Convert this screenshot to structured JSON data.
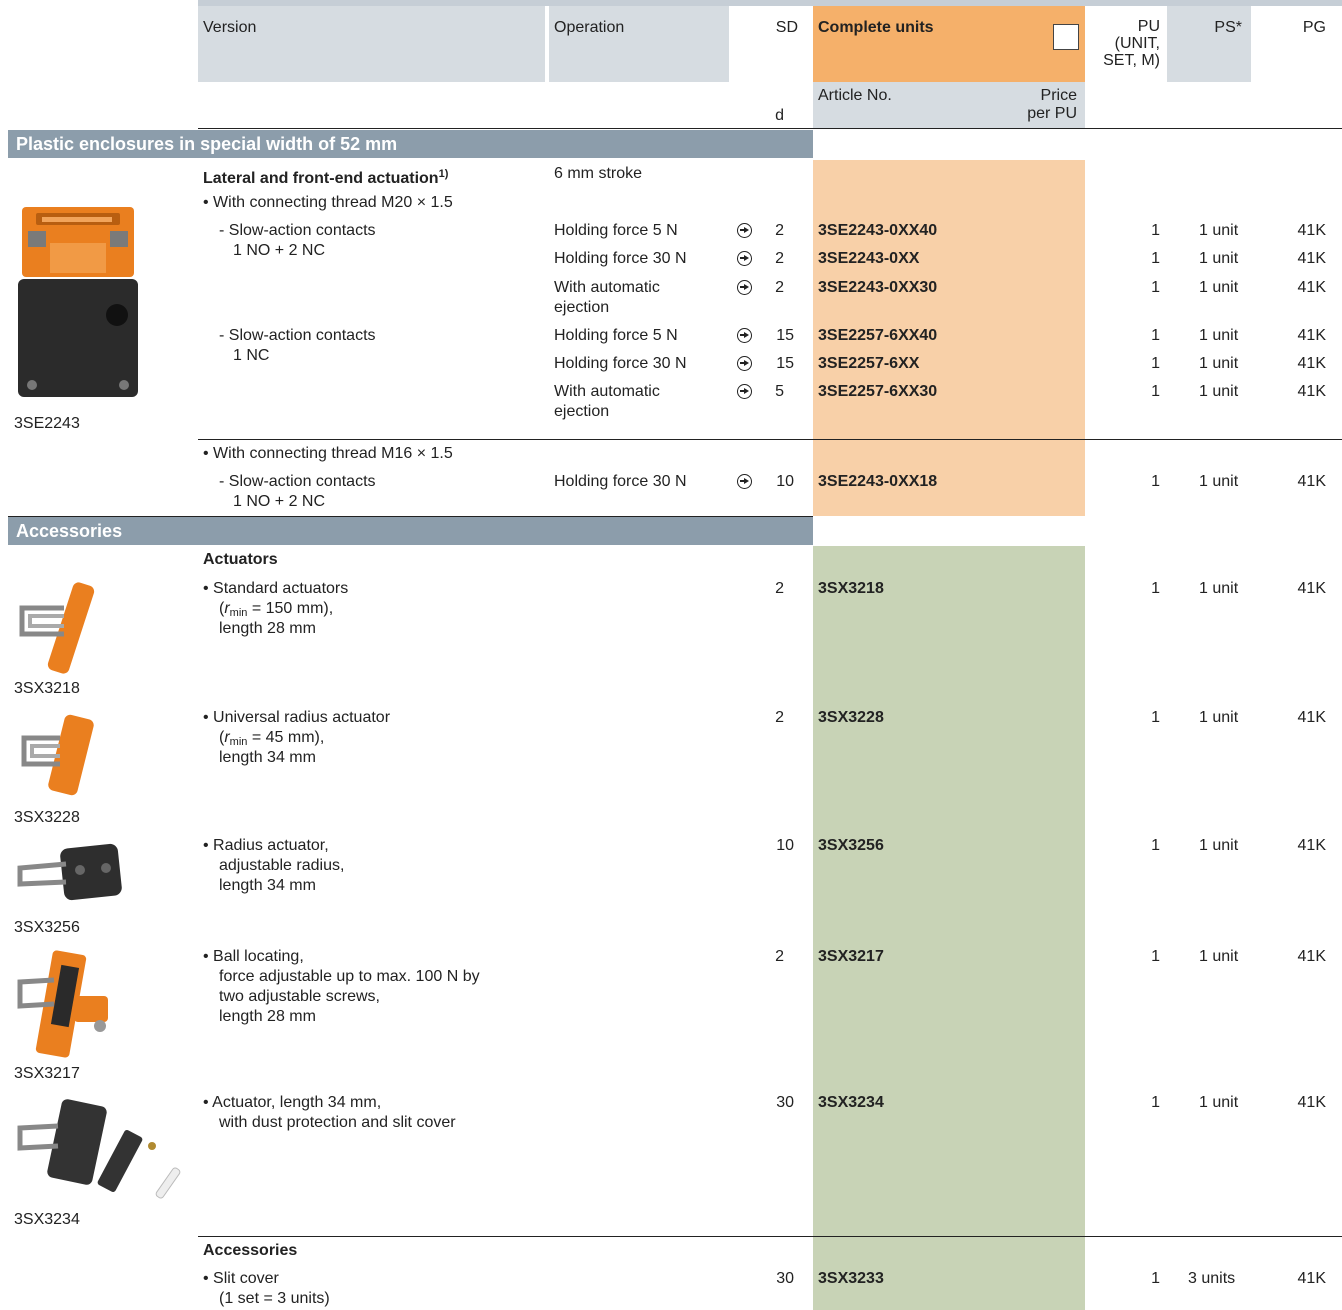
{
  "header": {
    "version": "Version",
    "operation": "Operation",
    "sd": "SD",
    "sd_unit": "d",
    "complete_units": "Complete units",
    "article_no": "Article No.",
    "price_1": "Price",
    "price_2": "per PU",
    "pu_1": "PU",
    "pu_2": "(UNIT,",
    "pu_3": "SET, M)",
    "ps": "PS*",
    "pg": "PG"
  },
  "section1": {
    "title": "Plastic enclosures in special width of 52 mm",
    "subheading": "Lateral and front-end actuation",
    "subheading_sup": "1)",
    "stroke": "6 mm stroke",
    "thread_m20": "• With connecting thread M20 × 1.5",
    "thread_m16": "• With connecting thread M16 × 1.5",
    "contacts_a1": "- Slow-action contacts",
    "contacts_a2": "1 NO + 2 NC",
    "contacts_b1": "- Slow-action contacts",
    "contacts_b2": "1 NC",
    "contacts_c1": "- Slow-action contacts",
    "contacts_c2": "1 NO + 2 NC",
    "image_caption": "3SE2243",
    "rows": [
      {
        "operation": "Holding force 5 N",
        "operation2": "",
        "sd": "2",
        "article": "3SE2243-0XX40",
        "pu": "1",
        "ps": "1 unit",
        "pg": "41K"
      },
      {
        "operation": "Holding force 30 N",
        "operation2": "",
        "sd": "2",
        "article": "3SE2243-0XX",
        "pu": "1",
        "ps": "1 unit",
        "pg": "41K"
      },
      {
        "operation": "With automatic",
        "operation2": "ejection",
        "sd": "2",
        "article": "3SE2243-0XX30",
        "pu": "1",
        "ps": "1 unit",
        "pg": "41K"
      },
      {
        "operation": "Holding force 5 N",
        "operation2": "",
        "sd": "15",
        "article": "3SE2257-6XX40",
        "pu": "1",
        "ps": "1 unit",
        "pg": "41K"
      },
      {
        "operation": "Holding force 30 N",
        "operation2": "",
        "sd": "15",
        "article": "3SE2257-6XX",
        "pu": "1",
        "ps": "1 unit",
        "pg": "41K"
      },
      {
        "operation": "With automatic",
        "operation2": "ejection",
        "sd": "5",
        "article": "3SE2257-6XX30",
        "pu": "1",
        "ps": "1 unit",
        "pg": "41K"
      },
      {
        "operation": "Holding force 30 N",
        "operation2": "",
        "sd": "10",
        "article": "3SE2243-0XX18",
        "pu": "1",
        "ps": "1 unit",
        "pg": "41K"
      }
    ]
  },
  "section2": {
    "title": "Accessories",
    "actuators_heading": "Actuators",
    "accessories_heading": "Accessories",
    "items": [
      {
        "l1": "• Standard actuators",
        "l2a": "(",
        "l2r": "r",
        "l2s": "min",
        "l2b": " = 150 mm),",
        "l3": "length 28 mm",
        "l4": "",
        "sd": "2",
        "article": "3SX3218",
        "pu": "1",
        "ps": "1 unit",
        "pg": "41K",
        "caption": "3SX3218"
      },
      {
        "l1": "• Universal radius actuator",
        "l2a": "(",
        "l2r": "r",
        "l2s": "min",
        "l2b": " = 45 mm),",
        "l3": "length 34 mm",
        "l4": "",
        "sd": "2",
        "article": "3SX3228",
        "pu": "1",
        "ps": "1 unit",
        "pg": "41K",
        "caption": "3SX3228"
      },
      {
        "l1": "• Radius actuator,",
        "l2": "adjustable radius,",
        "l3": "length 34 mm",
        "l4": "",
        "sd": "10",
        "article": "3SX3256",
        "pu": "1",
        "ps": "1 unit",
        "pg": "41K",
        "caption": "3SX3256"
      },
      {
        "l1": "• Ball locating,",
        "l2": "force adjustable up to max. 100 N by",
        "l3": "two adjustable screws,",
        "l4": "length 28 mm",
        "sd": "2",
        "article": "3SX3217",
        "pu": "1",
        "ps": "1 unit",
        "pg": "41K",
        "caption": "3SX3217"
      },
      {
        "l1": "• Actuator, length 34 mm,",
        "l2": "with dust protection and slit cover",
        "l3": "",
        "l4": "",
        "sd": "30",
        "article": "3SX3234",
        "pu": "1",
        "ps": "1 unit",
        "pg": "41K",
        "caption": "3SX3234"
      },
      {
        "l1": "• Slit cover",
        "l2": "(1 set = 3 units)",
        "l3": "",
        "l4": "",
        "sd": "30",
        "article": "3SX3233",
        "pu": "1",
        "ps": "3 units",
        "pg": "41K",
        "caption": ""
      }
    ]
  },
  "colors": {
    "band": "#8c9dab",
    "header_gray": "#d6dce1",
    "orange": "#f5b06a",
    "light_orange": "#f8d0a8",
    "green": "#c8d3b6"
  },
  "icons": {
    "operation_arrow": "circled-arrow-icon",
    "selector": "checkbox-icon"
  }
}
